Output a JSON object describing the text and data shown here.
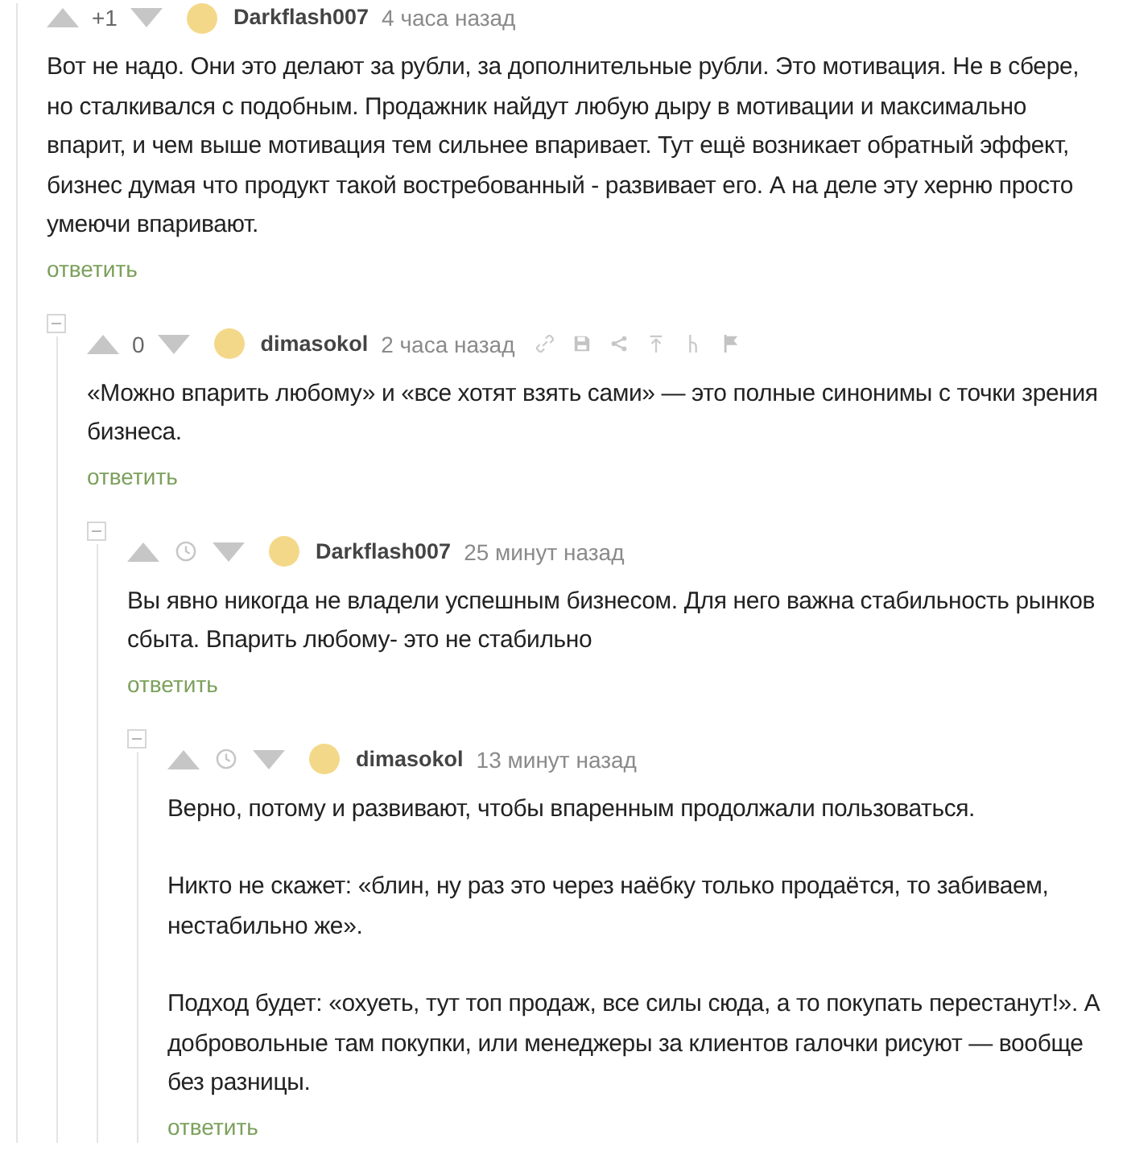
{
  "comments": [
    {
      "author": "Darkflash007",
      "time": "4 часа назад",
      "rating": {
        "kind": "score",
        "value": "+1"
      },
      "actions_shown": false,
      "paragraphs": [
        "Вот не надо. Они это делают за рубли, за дополнительные рубли. Это мотивация. Не в сбере, но сталкивался с подобным. Продажник найдут любую дыру в мотивации и максимально впарит, и чем выше мотивация тем сильнее впаривает. Тут ещё возникает обратный эффект, бизнес думая что продукт такой востребованный - развивает его. А на деле эту херню просто умеючи впаривают."
      ],
      "reply": "ответить",
      "replies": [
        {
          "expanded": true,
          "author": "dimasokol",
          "time": "2 часа назад",
          "rating": {
            "kind": "score",
            "value": "0"
          },
          "actions_shown": true,
          "paragraphs": [
            "«Можно впарить любому» и «все хотят взять сами» — это полные синонимы с точки зрения бизнеса."
          ],
          "reply": "ответить",
          "replies": [
            {
              "expanded": true,
              "author": "Darkflash007",
              "time": "25 минут назад",
              "rating": {
                "kind": "hidden"
              },
              "actions_shown": false,
              "paragraphs": [
                "Вы явно никогда не владели успешным бизнесом. Для него важна стабильность рынков сбыта. Впарить любому- это не стабильно"
              ],
              "reply": "ответить",
              "replies": [
                {
                  "expanded": true,
                  "author": "dimasokol",
                  "time": "13 минут назад",
                  "rating": {
                    "kind": "hidden"
                  },
                  "actions_shown": false,
                  "paragraphs": [
                    "Верно, потому и развивают, чтобы впаренным продолжали пользоваться.",
                    "Никто не скажет: «блин, ну раз это через наёбку только продаётся, то забиваем, нестабильно же».",
                    "Подход будет: «охуеть, тут топ продаж, все силы сюда, а то покупать перестанут!». А добровольные там покупки, или менеджеры за клиентов галочки рисуют — вообще без разницы."
                  ],
                  "reply": "ответить"
                }
              ]
            }
          ]
        }
      ]
    }
  ]
}
